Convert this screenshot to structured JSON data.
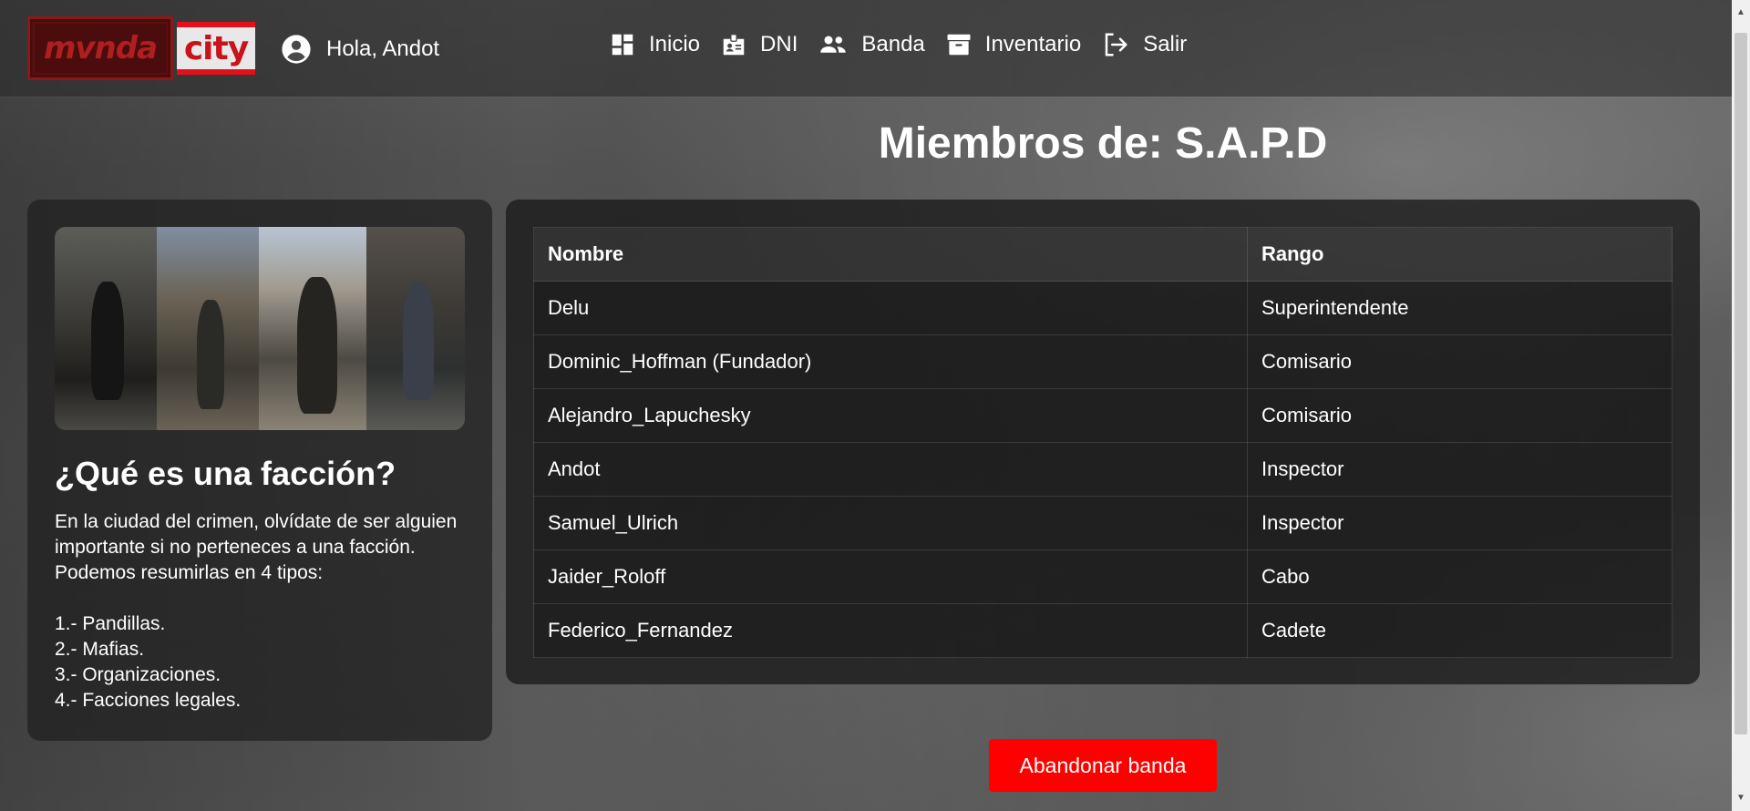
{
  "header": {
    "logo_left": "mvnda",
    "logo_right": "city",
    "greeting": "Hola, Andot",
    "nav": [
      {
        "label": "Inicio",
        "icon": "dashboard-icon"
      },
      {
        "label": "DNI",
        "icon": "id-badge-icon"
      },
      {
        "label": "Banda",
        "icon": "group-icon"
      },
      {
        "label": "Inventario",
        "icon": "archive-icon"
      },
      {
        "label": "Salir",
        "icon": "logout-icon"
      }
    ]
  },
  "page": {
    "title": "Miembros de: S.A.P.D"
  },
  "faction_info": {
    "heading": "¿Qué es una facción?",
    "paragraph": "En la ciudad del crimen, olvídate de ser alguien importante si no perteneces a una facción. Podemos resumirlas en 4 tipos:",
    "types": [
      "1.- Pandillas.",
      "2.- Mafias.",
      "3.- Organizaciones.",
      "4.- Facciones legales."
    ]
  },
  "members_table": {
    "headers": [
      "Nombre",
      "Rango"
    ],
    "rows": [
      [
        "Delu",
        "Superintendente"
      ],
      [
        "Dominic_Hoffman (Fundador)",
        "Comisario"
      ],
      [
        "Alejandro_Lapuchesky",
        "Comisario"
      ],
      [
        "Andot",
        "Inspector"
      ],
      [
        "Samuel_Ulrich",
        "Inspector"
      ],
      [
        "Jaider_Roloff",
        "Cabo"
      ],
      [
        "Federico_Fernandez",
        "Cadete"
      ]
    ]
  },
  "actions": {
    "leave_label": "Abandonar banda"
  },
  "colors": {
    "accent_red": "#ff0000",
    "logo_red": "#c7131b"
  }
}
